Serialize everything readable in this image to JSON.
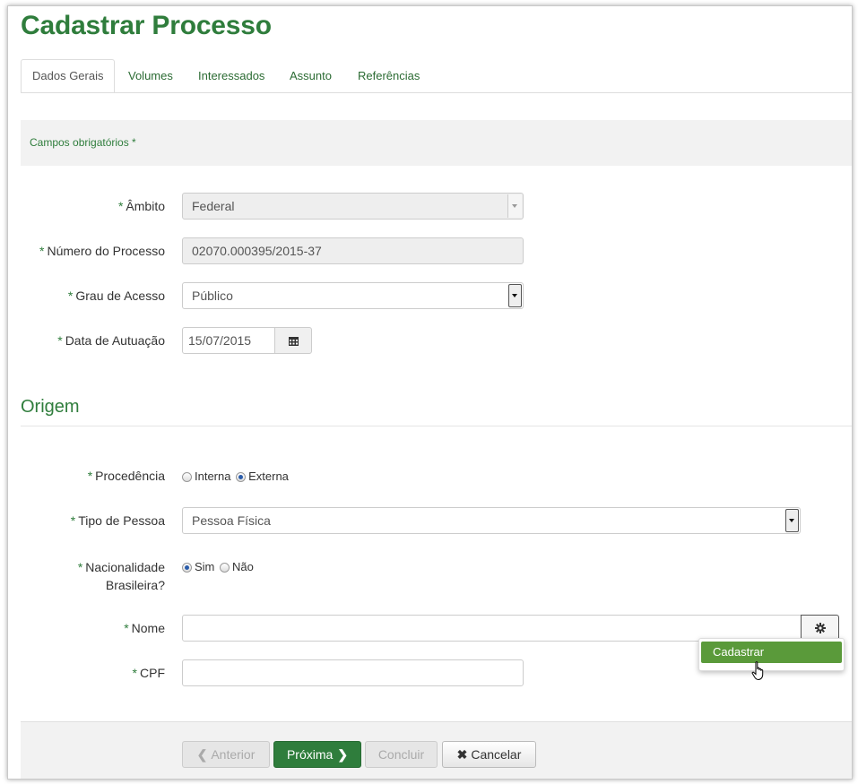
{
  "page": {
    "title": "Cadastrar Processo"
  },
  "tabs": [
    {
      "label": "Dados Gerais",
      "active": true
    },
    {
      "label": "Volumes"
    },
    {
      "label": "Interessados"
    },
    {
      "label": "Assunto"
    },
    {
      "label": "Referências"
    }
  ],
  "required_note": "Campos obrigatórios *",
  "required_mark": "*",
  "form": {
    "ambito": {
      "label": "Âmbito",
      "value": "Federal"
    },
    "numero": {
      "label": "Número do Processo",
      "value": "02070.000395/2015-37"
    },
    "grau": {
      "label": "Grau de Acesso",
      "value": "Público"
    },
    "data": {
      "label": "Data de Autuação",
      "value": "15/07/2015",
      "icon": "calendar-icon"
    }
  },
  "origem": {
    "heading": "Origem",
    "procedencia": {
      "label": "Procedência",
      "options": [
        "Interna",
        "Externa"
      ],
      "selected": "Externa"
    },
    "tipo_pessoa": {
      "label": "Tipo de Pessoa",
      "value": "Pessoa Física"
    },
    "nacionalidade": {
      "label_line1": "Nacionalidade",
      "label_line2": "Brasileira?",
      "options": [
        "Sim",
        "Não"
      ],
      "selected": "Sim"
    },
    "nome": {
      "label": "Nome",
      "value": "",
      "icon": "gear-icon"
    },
    "cpf": {
      "label": "CPF",
      "value": ""
    }
  },
  "dropdown_menu": {
    "item": "Cadastrar"
  },
  "footer": {
    "prev": "Anterior",
    "next": "Próxima",
    "done": "Concluir",
    "cancel": "Cancelar"
  },
  "colors": {
    "brand_green": "#2f7d3c",
    "menu_green": "#5a9a3a"
  }
}
